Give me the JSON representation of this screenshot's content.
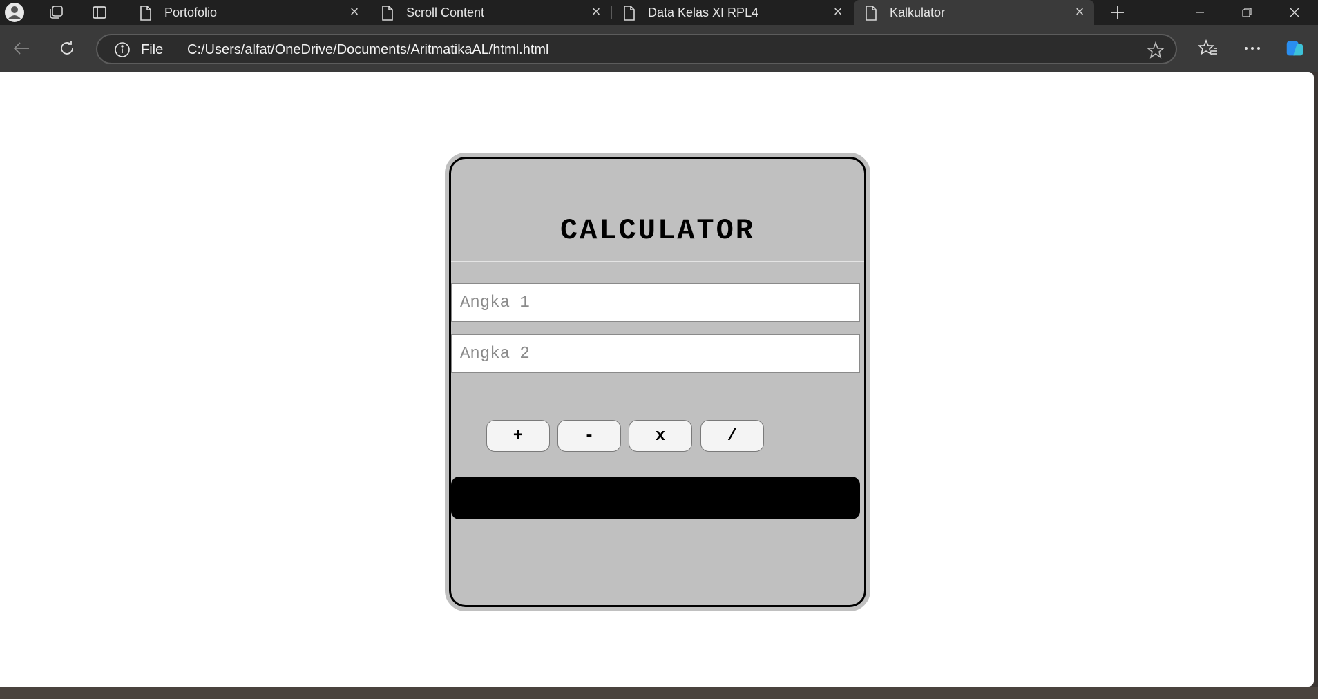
{
  "tabs": [
    {
      "title": "Portofolio"
    },
    {
      "title": "Scroll Content"
    },
    {
      "title": "Data Kelas XI RPL4"
    },
    {
      "title": "Kalkulator",
      "active": true
    }
  ],
  "address": {
    "scheme_label": "File",
    "url": "C:/Users/alfat/OneDrive/Documents/AritmatikaAL/html.html"
  },
  "calculator": {
    "title": "CALCULATOR",
    "input1": {
      "value": "",
      "placeholder": "Angka 1"
    },
    "input2": {
      "value": "",
      "placeholder": "Angka 2"
    },
    "operators": [
      "+",
      "-",
      "x",
      "/"
    ],
    "result": "",
    "colors": {
      "panel": "#c0c0c0",
      "border": "#000000",
      "result_bg": "#000000"
    }
  }
}
